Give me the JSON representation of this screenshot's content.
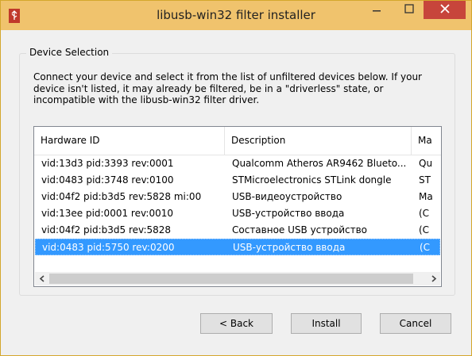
{
  "window": {
    "title": "libusb-win32 filter installer",
    "accent_color": "#f0c36d",
    "close_color": "#c7453b",
    "app_icon": "usb-icon"
  },
  "titlebar_buttons": {
    "minimize_icon": "minimize-icon",
    "maximize_icon": "maximize-icon",
    "close_icon": "close-icon"
  },
  "group": {
    "title": "Device Selection",
    "description": "Connect your device and select it from the list of unfiltered devices below. If your device isn't listed, it may already be filtered, be in a \"driverless\" state, or incompatible with the libusb-win32 filter driver."
  },
  "device_list": {
    "columns": [
      "Hardware ID",
      "Description",
      "Ma"
    ],
    "rows": [
      {
        "hardware_id": "vid:13d3 pid:3393 rev:0001",
        "description": "Qualcomm Atheros AR9462 Blueto...",
        "manufacturer": "Qu",
        "selected": false
      },
      {
        "hardware_id": "vid:0483 pid:3748 rev:0100",
        "description": "STMicroelectronics STLink dongle",
        "manufacturer": "ST",
        "selected": false
      },
      {
        "hardware_id": "vid:04f2 pid:b3d5 rev:5828 mi:00",
        "description": "USB-видеоустройство",
        "manufacturer": "Ma",
        "selected": false
      },
      {
        "hardware_id": "vid:13ee pid:0001 rev:0010",
        "description": "USB-устройство ввода",
        "manufacturer": "(C",
        "selected": false
      },
      {
        "hardware_id": "vid:04f2 pid:b3d5 rev:5828",
        "description": "Составное USB устройство",
        "manufacturer": "(C",
        "selected": false
      },
      {
        "hardware_id": "vid:0483 pid:5750 rev:0200",
        "description": "USB-устройство ввода",
        "manufacturer": "(C",
        "selected": true
      }
    ],
    "selection_color": "#3399ff",
    "scroll_left_icon": "chevron-left-icon",
    "scroll_right_icon": "chevron-right-icon"
  },
  "buttons": {
    "back": "< Back",
    "install": "Install",
    "cancel": "Cancel"
  }
}
